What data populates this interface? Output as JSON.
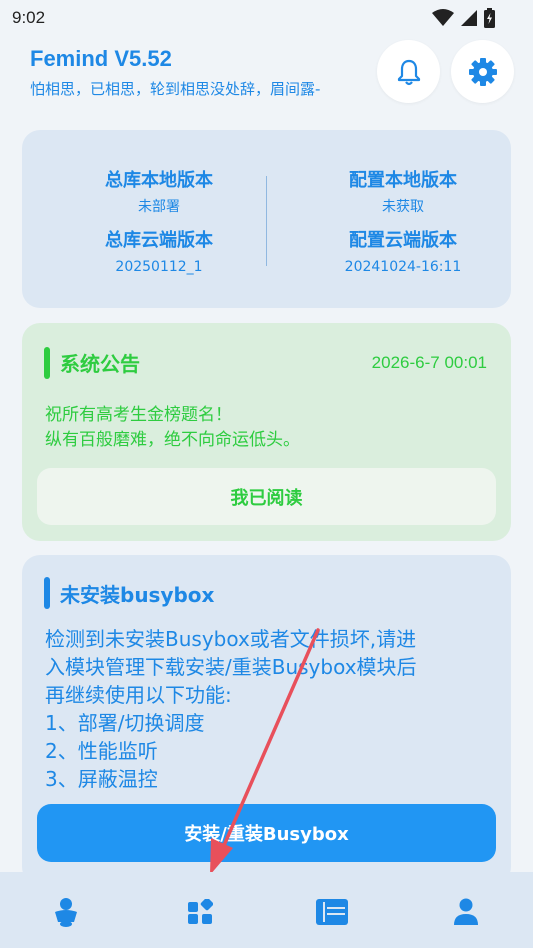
{
  "status_bar": {
    "time": "9:02"
  },
  "header": {
    "title": "Femind V5.52",
    "subtitle": "怕相思，已相思，轮到相思没处辞，眉间露-"
  },
  "version_card": {
    "left": [
      {
        "label": "总库本地版本",
        "value": "未部署"
      },
      {
        "label": "总库云端版本",
        "value": "20250112_1"
      }
    ],
    "right": [
      {
        "label": "配置本地版本",
        "value": "未获取"
      },
      {
        "label": "配置云端版本",
        "value": "20241024-16:11"
      }
    ]
  },
  "notice": {
    "title": "系统公告",
    "date": "2026-6-7 00:01",
    "lines": [
      "祝所有高考生金榜题名！",
      "纵有百般磨难，绝不向命运低头。"
    ],
    "button_label": "我已阅读"
  },
  "busybox": {
    "title": "未安装busybox",
    "lines": [
      "检测到未安装Busybox或者文件损坏,请进",
      "入模块管理下载安装/重装Busybox模块后",
      "再继续使用以下功能:",
      "1、部署/切换调度",
      "2、性能监听",
      "3、屏蔽温控"
    ],
    "button_label": "安装/重装Busybox"
  },
  "colors": {
    "accent": "#1e88e5",
    "green": "#2ecc40",
    "button_blue": "#2196f3",
    "annotation_arrow": "#e8505b"
  },
  "bottom_nav": {
    "items": [
      {
        "icon": "person-home-icon"
      },
      {
        "icon": "modules-grid-icon"
      },
      {
        "icon": "list-panel-icon"
      },
      {
        "icon": "user-profile-icon"
      }
    ]
  }
}
